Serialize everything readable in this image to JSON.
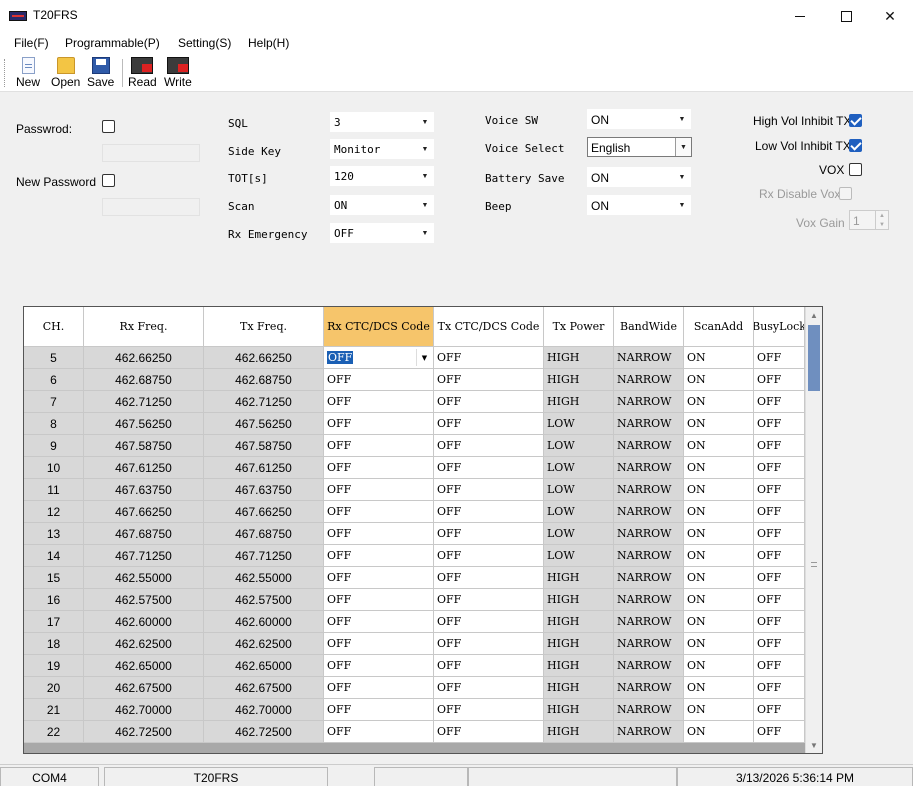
{
  "window": {
    "title": "T20FRS"
  },
  "menu": [
    "File(F)",
    "Programmable(P)",
    "Setting(S)",
    "Help(H)"
  ],
  "toolbar": {
    "new": "New",
    "open": "Open",
    "save": "Save",
    "read": "Read",
    "write": "Write"
  },
  "password": {
    "label": "Passwrod:",
    "checked": false,
    "value": ""
  },
  "new_password": {
    "label": "New Password",
    "checked": false,
    "value": ""
  },
  "settings_col1": [
    {
      "label": "SQL",
      "value": "3"
    },
    {
      "label": "Side Key",
      "value": "Monitor"
    },
    {
      "label": "TOT[s]",
      "value": "120"
    },
    {
      "label": "Scan",
      "value": "ON"
    },
    {
      "label": "Rx Emergency",
      "value": "OFF"
    }
  ],
  "settings_col2": [
    {
      "label": "Voice SW",
      "value": "ON"
    },
    {
      "label": "Voice Select",
      "value": "English"
    },
    {
      "label": "Battery Save",
      "value": "ON"
    },
    {
      "label": "Beep",
      "value": "ON"
    }
  ],
  "options": {
    "high_vol_inhibit": {
      "label": "High Vol Inhibit TX",
      "checked": true
    },
    "low_vol_inhibit": {
      "label": "Low Vol Inhibit TX",
      "checked": true
    },
    "vox": {
      "label": "VOX",
      "checked": false
    },
    "rx_disable_vox": {
      "label": "Rx Disable Vox",
      "checked": false
    },
    "vox_gain": {
      "label": "Vox Gain",
      "value": "1"
    }
  },
  "grid": {
    "columns": [
      "CH.",
      "Rx Freq.",
      "Tx Freq.",
      "Rx CTC/DCS Code",
      "Tx CTC/DCS Code",
      "Tx Power",
      "BandWide",
      "ScanAdd",
      "BusyLock"
    ],
    "rows": [
      [
        "5",
        "462.66250",
        "462.66250",
        "OFF",
        "OFF",
        "HIGH",
        "NARROW",
        "ON",
        "OFF"
      ],
      [
        "6",
        "462.68750",
        "462.68750",
        "OFF",
        "OFF",
        "HIGH",
        "NARROW",
        "ON",
        "OFF"
      ],
      [
        "7",
        "462.71250",
        "462.71250",
        "OFF",
        "OFF",
        "HIGH",
        "NARROW",
        "ON",
        "OFF"
      ],
      [
        "8",
        "467.56250",
        "467.56250",
        "OFF",
        "OFF",
        "LOW",
        "NARROW",
        "ON",
        "OFF"
      ],
      [
        "9",
        "467.58750",
        "467.58750",
        "OFF",
        "OFF",
        "LOW",
        "NARROW",
        "ON",
        "OFF"
      ],
      [
        "10",
        "467.61250",
        "467.61250",
        "OFF",
        "OFF",
        "LOW",
        "NARROW",
        "ON",
        "OFF"
      ],
      [
        "11",
        "467.63750",
        "467.63750",
        "OFF",
        "OFF",
        "LOW",
        "NARROW",
        "ON",
        "OFF"
      ],
      [
        "12",
        "467.66250",
        "467.66250",
        "OFF",
        "OFF",
        "LOW",
        "NARROW",
        "ON",
        "OFF"
      ],
      [
        "13",
        "467.68750",
        "467.68750",
        "OFF",
        "OFF",
        "LOW",
        "NARROW",
        "ON",
        "OFF"
      ],
      [
        "14",
        "467.71250",
        "467.71250",
        "OFF",
        "OFF",
        "LOW",
        "NARROW",
        "ON",
        "OFF"
      ],
      [
        "15",
        "462.55000",
        "462.55000",
        "OFF",
        "OFF",
        "HIGH",
        "NARROW",
        "ON",
        "OFF"
      ],
      [
        "16",
        "462.57500",
        "462.57500",
        "OFF",
        "OFF",
        "HIGH",
        "NARROW",
        "ON",
        "OFF"
      ],
      [
        "17",
        "462.60000",
        "462.60000",
        "OFF",
        "OFF",
        "HIGH",
        "NARROW",
        "ON",
        "OFF"
      ],
      [
        "18",
        "462.62500",
        "462.62500",
        "OFF",
        "OFF",
        "HIGH",
        "NARROW",
        "ON",
        "OFF"
      ],
      [
        "19",
        "462.65000",
        "462.65000",
        "OFF",
        "OFF",
        "HIGH",
        "NARROW",
        "ON",
        "OFF"
      ],
      [
        "20",
        "462.67500",
        "462.67500",
        "OFF",
        "OFF",
        "HIGH",
        "NARROW",
        "ON",
        "OFF"
      ],
      [
        "21",
        "462.70000",
        "462.70000",
        "OFF",
        "OFF",
        "HIGH",
        "NARROW",
        "ON",
        "OFF"
      ],
      [
        "22",
        "462.72500",
        "462.72500",
        "OFF",
        "OFF",
        "HIGH",
        "NARROW",
        "ON",
        "OFF"
      ]
    ]
  },
  "status": {
    "port": "COM4",
    "model": "T20FRS",
    "datetime": "3/13/2026 5:36:14 PM"
  },
  "colors": {
    "selected_header": "#f6c56b",
    "check_blue": "#1f5fbf",
    "selection": "#1a5fb4"
  }
}
